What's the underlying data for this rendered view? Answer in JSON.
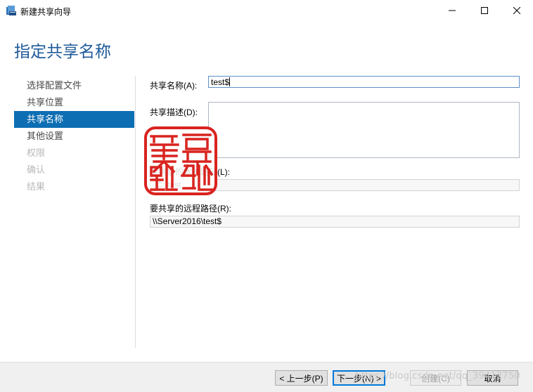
{
  "window": {
    "title": "新建共享向导",
    "icon": "share-wizard-icon"
  },
  "page": {
    "title": "指定共享名称"
  },
  "nav": {
    "items": [
      {
        "label": "选择配置文件",
        "state": "done"
      },
      {
        "label": "共享位置",
        "state": "done"
      },
      {
        "label": "共享名称",
        "state": "selected"
      },
      {
        "label": "其他设置",
        "state": "enabled"
      },
      {
        "label": "权限",
        "state": "disabled"
      },
      {
        "label": "确认",
        "state": "disabled"
      },
      {
        "label": "结果",
        "state": "disabled"
      }
    ]
  },
  "form": {
    "share_name_label": "共享名称(A):",
    "share_name_value": "test$",
    "share_desc_label": "共享描述(D):",
    "share_desc_value": "",
    "local_path_label": "要共享的本地路径(L):",
    "local_path_value": "C:\\test",
    "remote_path_label": "要共享的远程路径(R):",
    "remote_path_value": "\\\\Server2016\\test$"
  },
  "stamp": {
    "text": "美爱哲学"
  },
  "footer": {
    "back_label": "< 上一步(P)",
    "next_label": "下一步(N) >",
    "create_label": "创建(C)",
    "cancel_label": "取消"
  },
  "watermark": "https://blog.csdn.net/qq_39412750",
  "colors": {
    "accent": "#0d6eb3",
    "title": "#1e5a99",
    "stamp": "#d9231f"
  }
}
